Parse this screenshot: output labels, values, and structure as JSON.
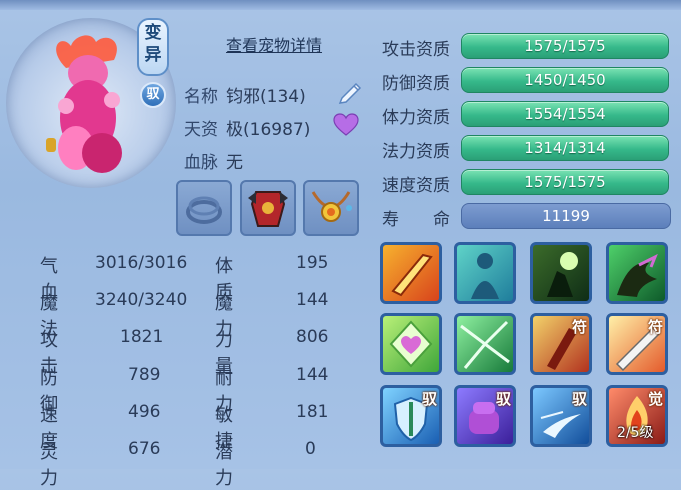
{
  "header": {
    "detail_link": "查看宠物详情"
  },
  "badges": {
    "variant": "变\n异",
    "tame": "驭"
  },
  "info": {
    "name_label": "名称",
    "name_value": "钧邪(134)",
    "talent_label": "天资",
    "talent_value": "极(16987)",
    "bloodline_label": "血脉",
    "bloodline_value": "无"
  },
  "equipment": [
    {
      "name": "collar-slot"
    },
    {
      "name": "armor-slot"
    },
    {
      "name": "necklace-slot"
    }
  ],
  "stats": [
    {
      "label": "气血",
      "value": "3016/3016",
      "label2": "体质",
      "value2": "195"
    },
    {
      "label": "魔法",
      "value": "3240/3240",
      "label2": "魔力",
      "value2": "144"
    },
    {
      "label": "攻击",
      "value": "1821",
      "label2": "力量",
      "value2": "806"
    },
    {
      "label": "防御",
      "value": "789",
      "label2": "耐力",
      "value2": "144"
    },
    {
      "label": "速度",
      "value": "496",
      "label2": "敏捷",
      "value2": "181"
    },
    {
      "label": "灵力",
      "value": "676",
      "label2": "潜力",
      "value2": "0"
    }
  ],
  "aptitudes": [
    {
      "label": "攻击资质",
      "value": "1575/1575"
    },
    {
      "label": "防御资质",
      "value": "1450/1450"
    },
    {
      "label": "体力资质",
      "value": "1554/1554"
    },
    {
      "label": "法力资质",
      "value": "1314/1314"
    },
    {
      "label": "速度资质",
      "value": "1575/1575"
    }
  ],
  "life": {
    "label": "寿　　命",
    "value": "11199"
  },
  "skills": [
    {
      "icon": "sword-slash-icon",
      "tag": "",
      "level": ""
    },
    {
      "icon": "spirit-figure-icon",
      "tag": "",
      "level": ""
    },
    {
      "icon": "warrior-moon-icon",
      "tag": "",
      "level": ""
    },
    {
      "icon": "shadow-claw-icon",
      "tag": "",
      "level": ""
    },
    {
      "icon": "heart-shield-icon",
      "tag": "",
      "level": ""
    },
    {
      "icon": "shatter-icon",
      "tag": "",
      "level": ""
    },
    {
      "icon": "talisman-strike-icon",
      "tag": "符",
      "level": ""
    },
    {
      "icon": "talisman-blade-icon",
      "tag": "符",
      "level": ""
    },
    {
      "icon": "guard-shield-icon",
      "tag": "驭",
      "level": ""
    },
    {
      "icon": "purple-fist-icon",
      "tag": "驭",
      "level": ""
    },
    {
      "icon": "swift-runner-icon",
      "tag": "驭",
      "level": ""
    },
    {
      "icon": "awaken-flame-icon",
      "tag": "觉",
      "level": "2/5级"
    }
  ],
  "colors": {
    "aptitude_bar": "#36b98b",
    "life_bar": "#5c7fbb",
    "background": "#a9c4e6"
  }
}
